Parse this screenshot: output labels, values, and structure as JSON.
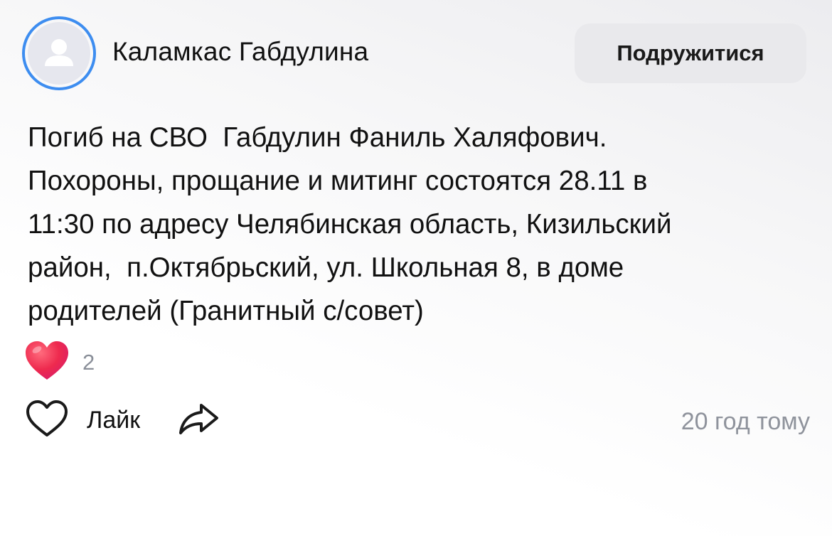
{
  "author": {
    "name": "Каламкас Габдулина",
    "avatar_icon": "user-silhouette-icon",
    "ring_color": "#3d8df0"
  },
  "header": {
    "add_friend_label": "Подружитися"
  },
  "post": {
    "text": "Погиб на СВО  Габдулин Фаниль Халяфович.\nПохороны, прощание и митинг состоятся 28.11 в\n11:30 по адресу Челябинская область, Кизильский\nрайон,  п.Октябрьский, ул. Школьная 8, в доме\nродителей (Гранитный с/совет)"
  },
  "reactions": {
    "icon": "heart-reaction-icon",
    "count": "2",
    "color": "#e8264a"
  },
  "actions": {
    "like_label": "Лайк",
    "like_icon": "heart-outline-icon",
    "share_icon": "share-arrow-icon"
  },
  "meta": {
    "timestamp": "20 год тому"
  }
}
